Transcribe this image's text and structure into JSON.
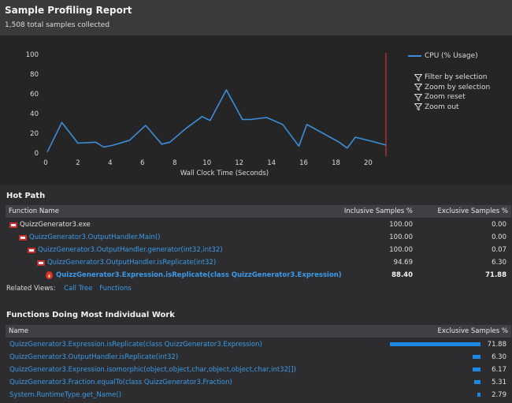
{
  "header": {
    "title": "Sample Profiling Report",
    "subtitle": "1,508 total samples collected"
  },
  "chart_data": {
    "type": "line",
    "xlabel": "Wall Clock Time (Seconds)",
    "ylabel": "",
    "xlim": [
      0,
      21.2
    ],
    "ylim": [
      0,
      100
    ],
    "x_ticks": [
      0,
      2,
      4,
      6,
      8,
      10,
      12,
      14,
      16,
      18,
      20
    ],
    "y_ticks": [
      0,
      20,
      40,
      60,
      80,
      100
    ],
    "legend_position": "top-right",
    "series": [
      {
        "name": "CPU (% Usage)",
        "color": "#3b8fdb",
        "x": [
          0.1,
          1.0,
          2.0,
          3.1,
          3.6,
          4.2,
          5.2,
          6.2,
          7.2,
          7.7,
          8.7,
          9.7,
          10.2,
          11.2,
          12.2,
          12.7,
          13.7,
          14.7,
          15.7,
          16.2,
          17.2,
          18.2,
          18.7,
          19.2,
          20.2,
          21.1
        ],
        "y": [
          1,
          31,
          10,
          11,
          6,
          8,
          13,
          28,
          9,
          11,
          25,
          37,
          33,
          64,
          34,
          34,
          36,
          29,
          7,
          29,
          20,
          11,
          5,
          16,
          12,
          8
        ]
      }
    ],
    "marker_line_x": 21.1
  },
  "chart_tools": [
    {
      "label": "Filter by selection",
      "icon": "funnel-icon"
    },
    {
      "label": "Zoom by selection",
      "icon": "funnel-icon"
    },
    {
      "label": "Zoom reset",
      "icon": "funnel-icon"
    },
    {
      "label": "Zoom out",
      "icon": "funnel-icon"
    }
  ],
  "hot_path": {
    "title": "Hot Path",
    "columns": {
      "name": "Function Name",
      "inclusive": "Inclusive Samples %",
      "exclusive": "Exclusive Samples %"
    },
    "rows": [
      {
        "name": "QuizzGenerator3.exe",
        "inclusive": "100.00",
        "exclusive": "0.00",
        "style": "plain",
        "icon": "process-icon"
      },
      {
        "name": "QuizzGenerator3.OutputHandler.Main()",
        "inclusive": "100.00",
        "exclusive": "0.00",
        "style": "link",
        "icon": "function-icon"
      },
      {
        "name": "QuizzGenerator3.OutputHandler.generator(int32,int32)",
        "inclusive": "100.00",
        "exclusive": "0.07",
        "style": "link",
        "icon": "function-icon"
      },
      {
        "name": "QuizzGenerator3.OutputHandler.isReplicate(int32)",
        "inclusive": "94.69",
        "exclusive": "6.30",
        "style": "link",
        "icon": "function-icon"
      },
      {
        "name": "QuizzGenerator3.Expression.isReplicate(class QuizzGenerator3.Expression)",
        "inclusive": "88.40",
        "exclusive": "71.88",
        "style": "hot",
        "icon": "flame-icon"
      }
    ]
  },
  "related_views": {
    "label": "Related Views:",
    "links": [
      "Call Tree",
      "Functions"
    ]
  },
  "individual_work": {
    "title": "Functions Doing Most Individual Work",
    "columns": {
      "name": "Name",
      "exclusive": "Exclusive Samples %"
    },
    "rows": [
      {
        "name": "QuizzGenerator3.Expression.isReplicate(class QuizzGenerator3.Expression)",
        "value": "71.88",
        "pct": 71.88
      },
      {
        "name": "QuizzGenerator3.OutputHandler.isReplicate(int32)",
        "value": "6.30",
        "pct": 6.3
      },
      {
        "name": "QuizzGenerator3.Expression.isomorphic(object,object,char,object,object,char,int32[])",
        "value": "6.17",
        "pct": 6.17
      },
      {
        "name": "QuizzGenerator3.Fraction.equalTo(class QuizzGenerator3.Fraction)",
        "value": "5.31",
        "pct": 5.31
      },
      {
        "name": "System.RuntimeType.get_Name()",
        "value": "2.79",
        "pct": 2.79
      }
    ]
  }
}
